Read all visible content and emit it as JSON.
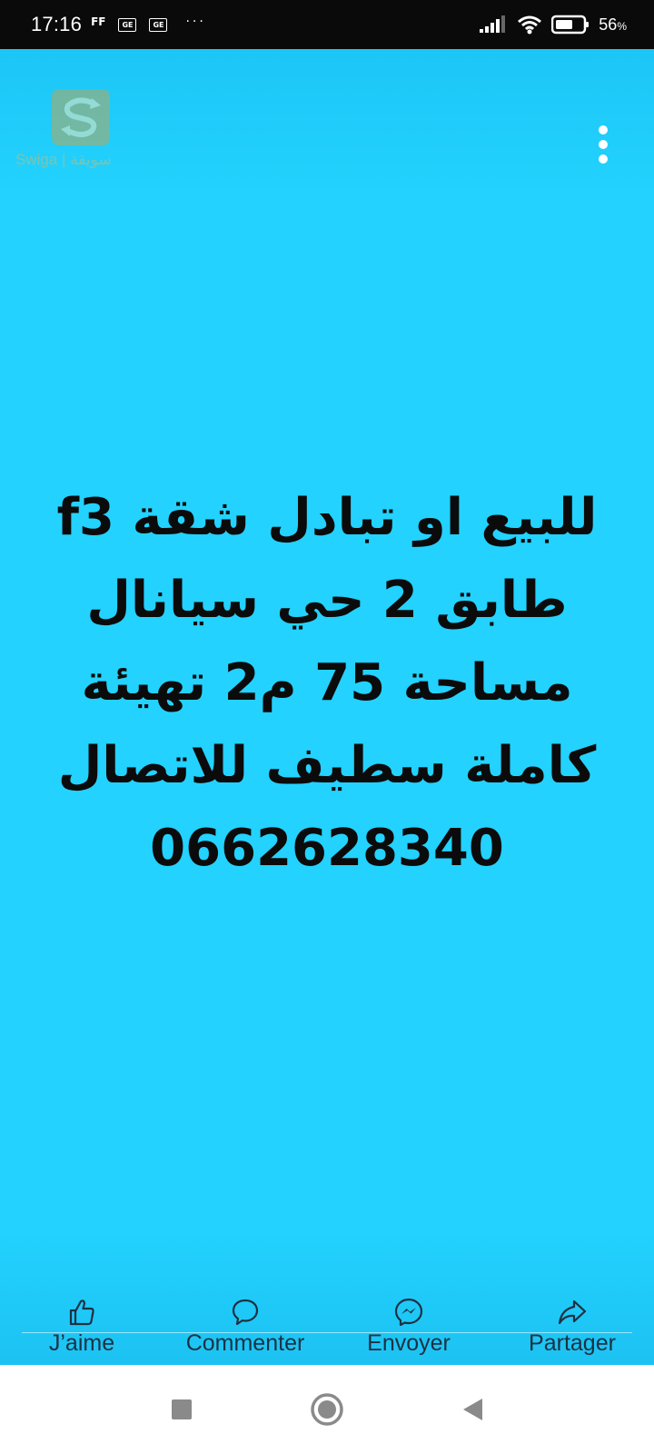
{
  "status_bar": {
    "time": "17:16",
    "ff": "FF",
    "notif_icon_1": "GE",
    "notif_icon_2": "GE",
    "more": "···",
    "battery_percent": "56",
    "battery_unit": "%",
    "icons": [
      "signal-icon",
      "wifi-icon",
      "battery-icon"
    ]
  },
  "media": {
    "background_color": "#23d2fe",
    "watermark_text": "Swiga | سويقة",
    "post_lines": [
      "للبيع او تبادل شقة  f3",
      "طابق 2 حي سيانال",
      "مساحة 75 م2 تهيئة",
      "كاملة سطيف للاتصال",
      "0662628340"
    ]
  },
  "actions": [
    {
      "label": "J’aime",
      "icon": "thumbs-up-icon"
    },
    {
      "label": "Commenter",
      "icon": "comment-icon"
    },
    {
      "label": "Envoyer",
      "icon": "messenger-icon"
    },
    {
      "label": "Partager",
      "icon": "share-icon"
    }
  ],
  "nav": {
    "buttons": [
      "recents-square-icon",
      "home-circle-icon",
      "back-triangle-icon"
    ]
  }
}
